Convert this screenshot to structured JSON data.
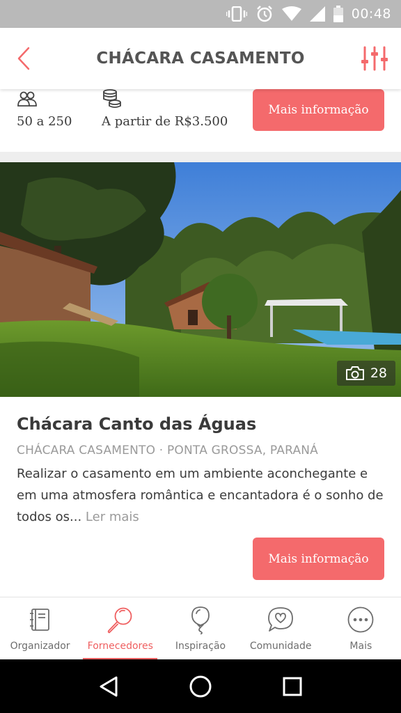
{
  "status_bar": {
    "time": "00:48"
  },
  "header": {
    "title": "CHÁCARA CASAMENTO"
  },
  "prev_card": {
    "guests": "50 a 250",
    "price": "A partir de R$3.500",
    "button_label": "Mais informação"
  },
  "card": {
    "photo_count": "28",
    "title": "Chácara Canto das Águas",
    "subtitle": "CHÁCARA CASAMENTO · PONTA GROSSA, PARANÁ",
    "description": "Realizar o casamento em um ambiente aconchegante e em uma atmosfera romântica e encantadora é o sonho de todos os...",
    "read_more": "Ler mais",
    "button_label": "Mais informação"
  },
  "bottom_nav": {
    "items": [
      {
        "label": "Organizador",
        "icon": "notebook-icon",
        "active": false
      },
      {
        "label": "Fornecedores",
        "icon": "magnifier-icon",
        "active": true
      },
      {
        "label": "Inspiração",
        "icon": "balloon-icon",
        "active": false
      },
      {
        "label": "Comunidade",
        "icon": "chat-heart-icon",
        "active": false
      },
      {
        "label": "Mais",
        "icon": "more-icon",
        "active": false
      }
    ]
  },
  "colors": {
    "accent": "#f46a6c",
    "status_bar": "#b9b9b9"
  }
}
